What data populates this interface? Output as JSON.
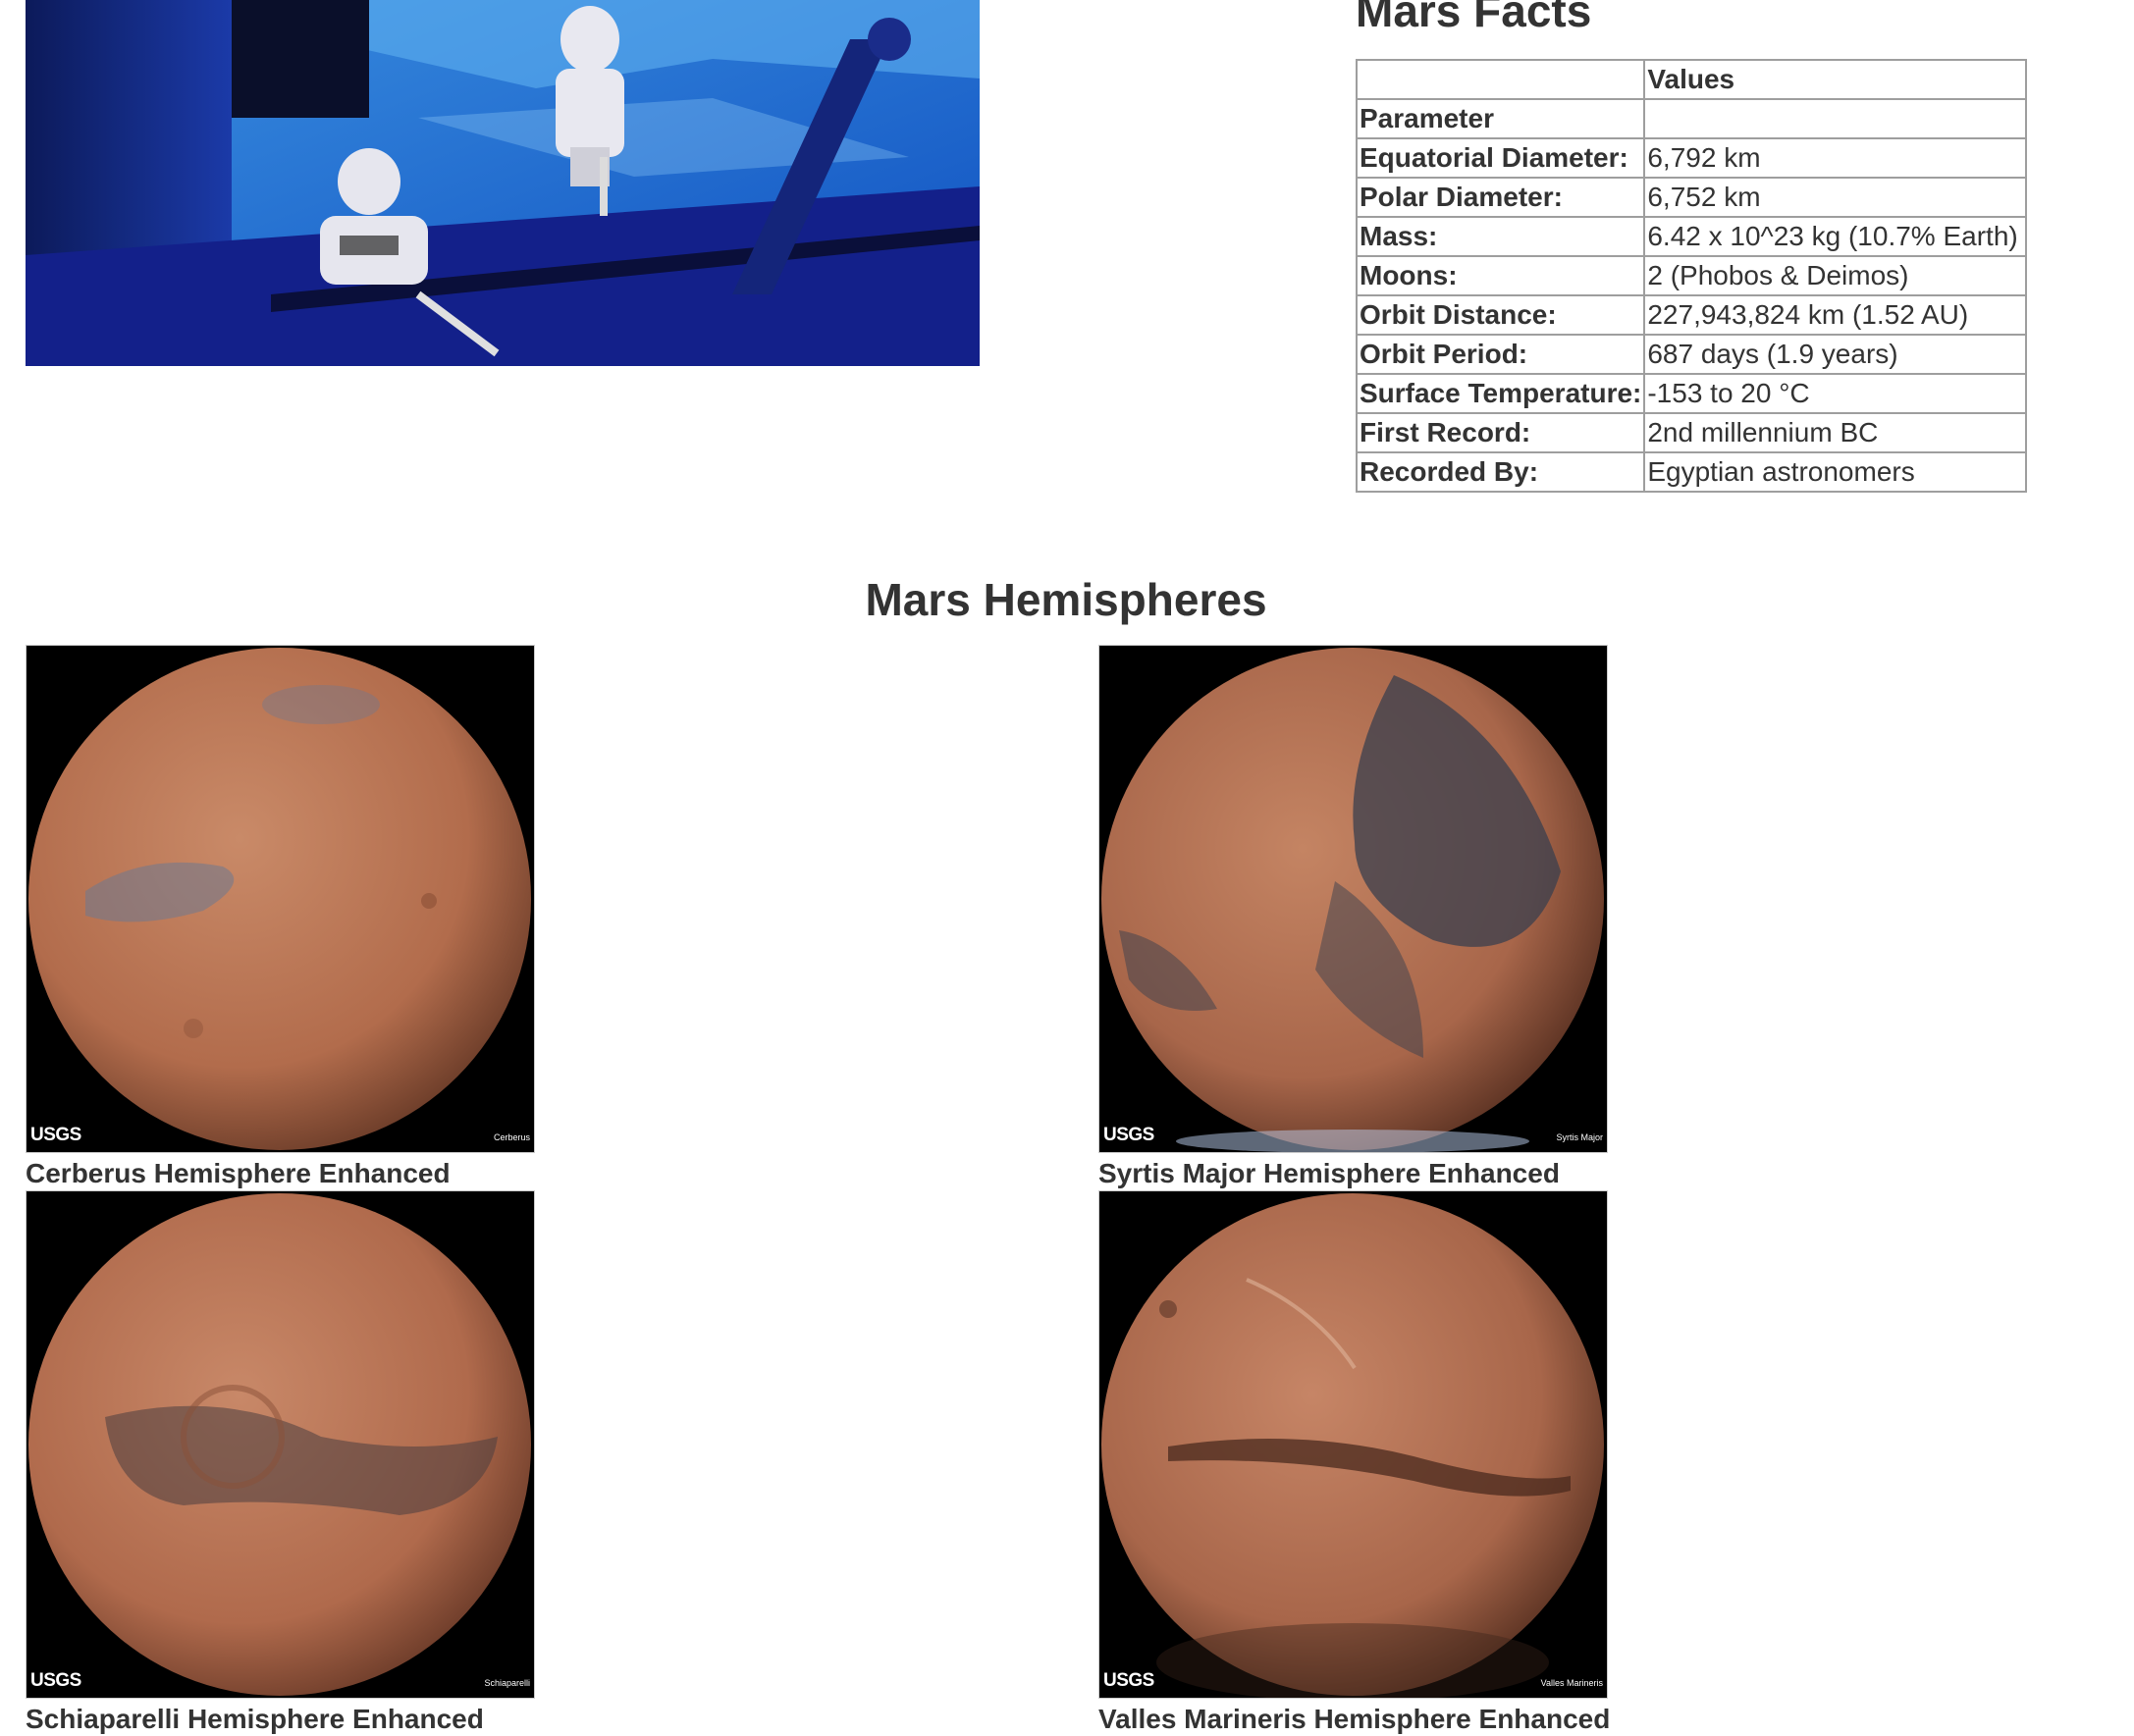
{
  "featured": {
    "alt": "Astronauts on spacewalk"
  },
  "facts": {
    "title": "Mars Facts",
    "header_blank": "",
    "header_values": "Values",
    "header_parameter": "Parameter",
    "rows": [
      {
        "label": "Equatorial Diameter:",
        "value": "6,792 km"
      },
      {
        "label": "Polar Diameter:",
        "value": "6,752 km"
      },
      {
        "label": "Mass:",
        "value": "6.42 x 10^23 kg (10.7% Earth)"
      },
      {
        "label": "Moons:",
        "value": "2 (Phobos & Deimos)"
      },
      {
        "label": "Orbit Distance:",
        "value": "227,943,824 km (1.52 AU)"
      },
      {
        "label": "Orbit Period:",
        "value": "687 days (1.9 years)"
      },
      {
        "label": "Surface Temperature:",
        "value": "-153 to 20 °C"
      },
      {
        "label": "First Record:",
        "value": "2nd millennium BC"
      },
      {
        "label": "Recorded By:",
        "value": "Egyptian astronomers"
      }
    ]
  },
  "hemispheres": {
    "title": "Mars Hemispheres",
    "items": [
      {
        "label": "Cerberus Hemisphere Enhanced",
        "logo": "USGS",
        "tag": "Cerberus"
      },
      {
        "label": "Syrtis Major Hemisphere Enhanced",
        "logo": "USGS",
        "tag": "Syrtis Major"
      },
      {
        "label": "Schiaparelli Hemisphere Enhanced",
        "logo": "USGS",
        "tag": "Schiaparelli"
      },
      {
        "label": "Valles Marineris Hemisphere Enhanced",
        "logo": "USGS",
        "tag": "Valles Marineris"
      }
    ]
  },
  "colors": {
    "text": "#333333",
    "table_border": "#9e9e9e",
    "mars_base": "#b8704f",
    "space_blue": "#0a2a9a"
  }
}
